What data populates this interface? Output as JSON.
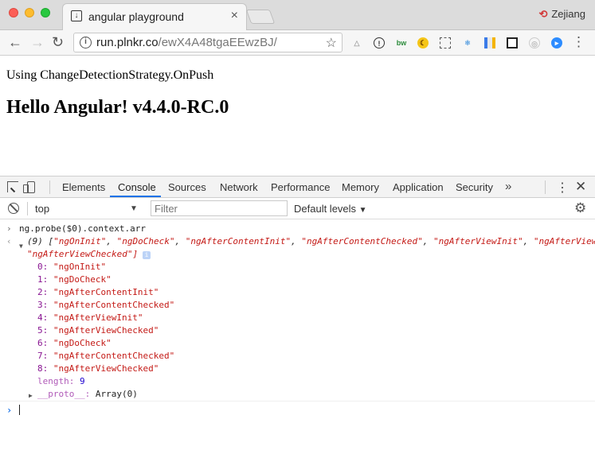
{
  "browser": {
    "tab_title": "angular playground",
    "tab_close": "×",
    "profile_name": "Zejiang",
    "url_host": "run.plnkr.co",
    "url_path": "/ewX4A48tgaEEwzBJ/"
  },
  "page": {
    "strategy_text": "Using ChangeDetectionStrategy.OnPush",
    "heading": "Hello Angular! v4.4.0-RC.0"
  },
  "devtools": {
    "tabs": [
      "Elements",
      "Console",
      "Sources",
      "Network",
      "Performance",
      "Memory",
      "Application",
      "Security"
    ],
    "active_tab": "Console",
    "context": "top",
    "filter_placeholder": "Filter",
    "levels": "Default levels"
  },
  "console": {
    "command": "ng.probe($0).context.arr",
    "summary_count": "(9)",
    "summary_items": [
      "\"ngOnInit\"",
      "\"ngDoCheck\"",
      "\"ngAfterContentInit\"",
      "\"ngAfterContentChecked\"",
      "\"ngAfterViewInit\"",
      "\"ngAfterView"
    ],
    "summary_tail": "\"ngAfterViewChecked\"]",
    "items": [
      {
        "index": "0",
        "value": "\"ngOnInit\""
      },
      {
        "index": "1",
        "value": "\"ngDoCheck\""
      },
      {
        "index": "2",
        "value": "\"ngAfterContentInit\""
      },
      {
        "index": "3",
        "value": "\"ngAfterContentChecked\""
      },
      {
        "index": "4",
        "value": "\"ngAfterViewInit\""
      },
      {
        "index": "5",
        "value": "\"ngAfterViewChecked\""
      },
      {
        "index": "6",
        "value": "\"ngDoCheck\""
      },
      {
        "index": "7",
        "value": "\"ngAfterContentChecked\""
      },
      {
        "index": "8",
        "value": "\"ngAfterViewChecked\""
      }
    ],
    "length_key": "length",
    "length_value": "9",
    "proto_key": "__proto__",
    "proto_value": "Array(0)"
  }
}
